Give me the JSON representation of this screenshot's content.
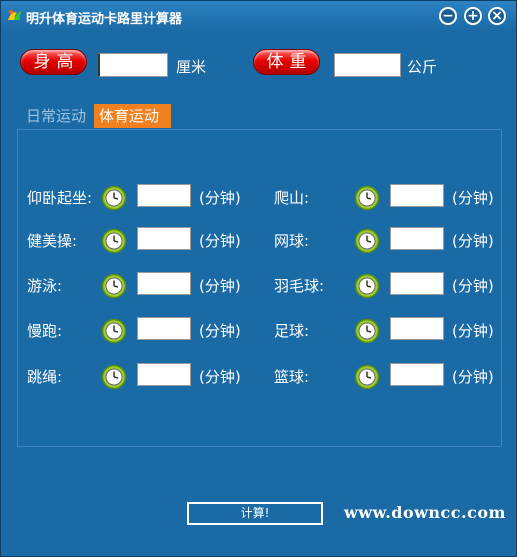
{
  "window": {
    "title": "明升体育运动卡路里计算器",
    "min_symbol": "−",
    "max_symbol": "+",
    "close_symbol": "×"
  },
  "body": {
    "height_label": "身高",
    "height_unit": "厘米",
    "weight_label": "体重",
    "weight_unit": "公斤"
  },
  "tabs": [
    {
      "label": "日常运动",
      "active": false
    },
    {
      "label": "体育运动",
      "active": true
    }
  ],
  "minute_unit": "(分钟)",
  "activities_left": [
    "仰卧起坐:",
    "健美操:",
    "游泳:",
    "慢跑:",
    "跳绳:"
  ],
  "activities_right": [
    "爬山:",
    "网球:",
    "羽毛球:",
    "足球:",
    "篮球:"
  ],
  "calculate_label": "计算!",
  "watermark": "www.downcc.com",
  "colors": {
    "background": "#1a6aa6",
    "accent": "#f08020",
    "pill": "#e60000"
  }
}
